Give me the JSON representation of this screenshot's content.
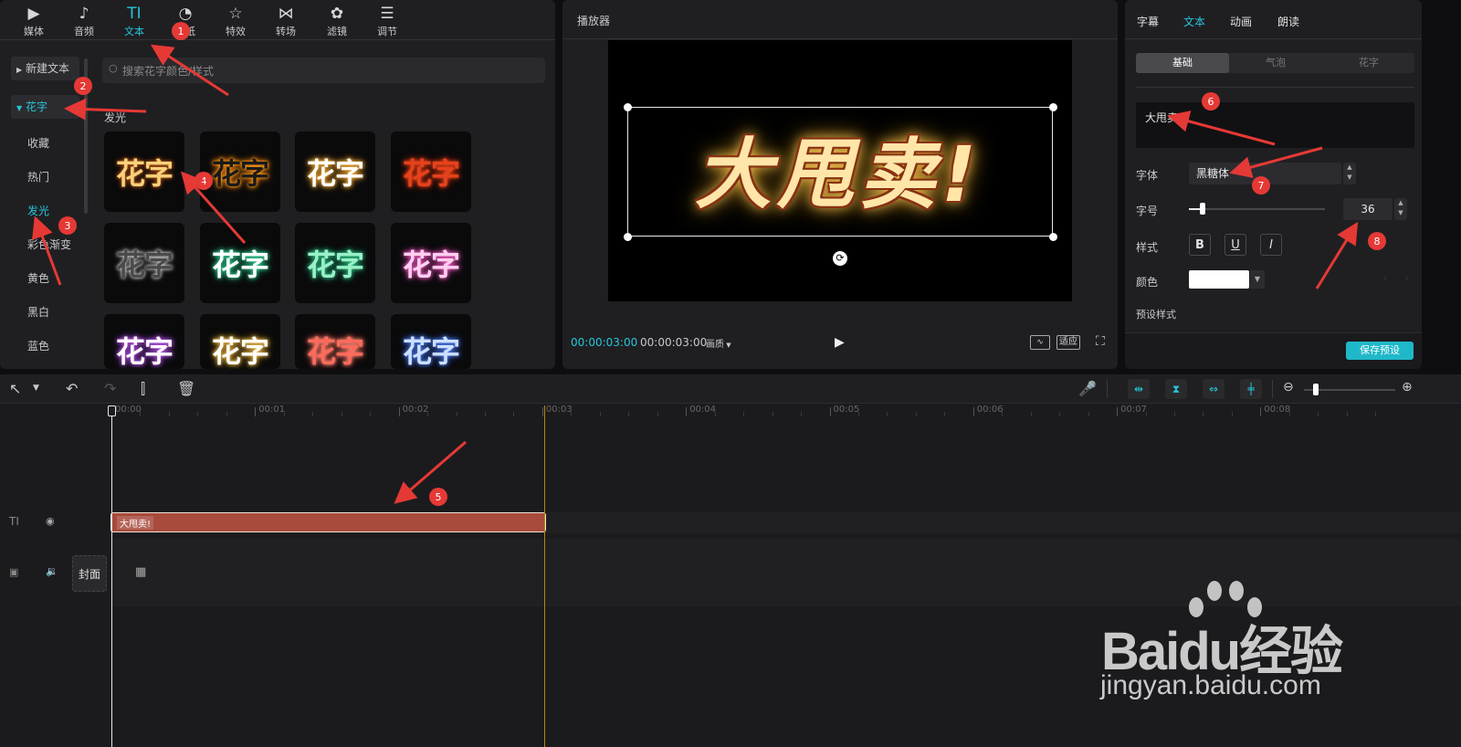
{
  "left_panel": {
    "top_tabs": [
      {
        "label": "媒体",
        "icon": "media-icon"
      },
      {
        "label": "音频",
        "icon": "audio-icon"
      },
      {
        "label": "文本",
        "icon": "text-icon",
        "glyph": "TI"
      },
      {
        "label": "贴纸",
        "icon": "sticker-icon"
      },
      {
        "label": "特效",
        "icon": "effects-icon"
      },
      {
        "label": "转场",
        "icon": "transition-icon"
      },
      {
        "label": "滤镜",
        "icon": "filter-icon"
      },
      {
        "label": "调节",
        "icon": "adjust-icon"
      }
    ],
    "new_text": "新建文本",
    "huazi": "花字",
    "categories": [
      "收藏",
      "热门",
      "发光",
      "彩色渐变",
      "黄色",
      "黑白",
      "蓝色"
    ],
    "search_placeholder": "搜索花字颜色/样式",
    "section_title": "发光",
    "thumb_text": "花字"
  },
  "player": {
    "title": "播放器",
    "preview_text": "大甩卖!",
    "current_time": "00:00:03:00",
    "total_time": "00:00:03:00",
    "quality": "画质",
    "fit": "适应"
  },
  "inspector": {
    "tabs": [
      "字幕",
      "文本",
      "动画",
      "朗读"
    ],
    "sub_tabs": [
      "基础",
      "气泡",
      "花字"
    ],
    "text_value": "大甩卖!",
    "font_label": "字体",
    "font_value": "黑糖体",
    "size_label": "字号",
    "size_value": "36",
    "size_fraction": 0.1,
    "style_label": "样式",
    "style_buttons": [
      "B",
      "U",
      "I"
    ],
    "color_label": "颜色",
    "color_value": "#ffffff",
    "preset_label": "预设样式",
    "save_preset": "保存预设"
  },
  "timeline": {
    "ticks": [
      "00:00",
      "00:01",
      "00:02",
      "00:03",
      "00:04",
      "00:05",
      "00:06",
      "00:07",
      "00:08"
    ],
    "text_clip_label": "大甩卖!",
    "cover_label": "封面",
    "accent": "#26c6da",
    "clip_color": "#a84a3c"
  },
  "annotations": [
    "1",
    "2",
    "3",
    "4",
    "5",
    "6",
    "7",
    "8"
  ],
  "watermark": {
    "brand": "Baidu经验",
    "url": "jingyan.baidu.com"
  }
}
